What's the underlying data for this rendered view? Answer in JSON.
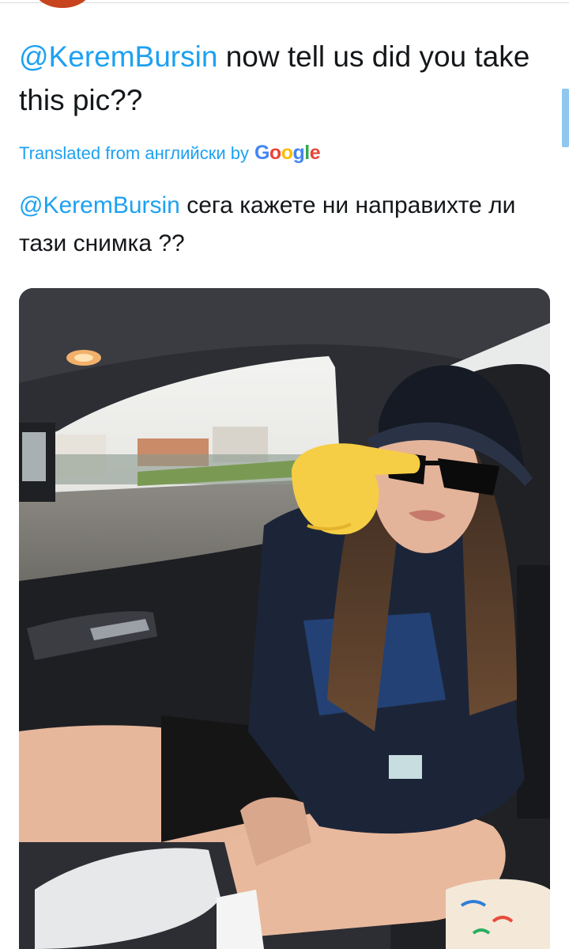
{
  "tweet": {
    "mention": "@KeremBursin",
    "text": "now tell us did you take this pic??"
  },
  "translation": {
    "label": "Translated from английски by",
    "provider_letters": [
      "G",
      "o",
      "o",
      "g",
      "l",
      "e"
    ],
    "mention": "@KeremBursin",
    "text": "сега кажете ни направихте ли тази снимка ??"
  },
  "colors": {
    "link": "#1da1f2",
    "text": "#14171a",
    "scrollbar": "#8fc7ee"
  }
}
